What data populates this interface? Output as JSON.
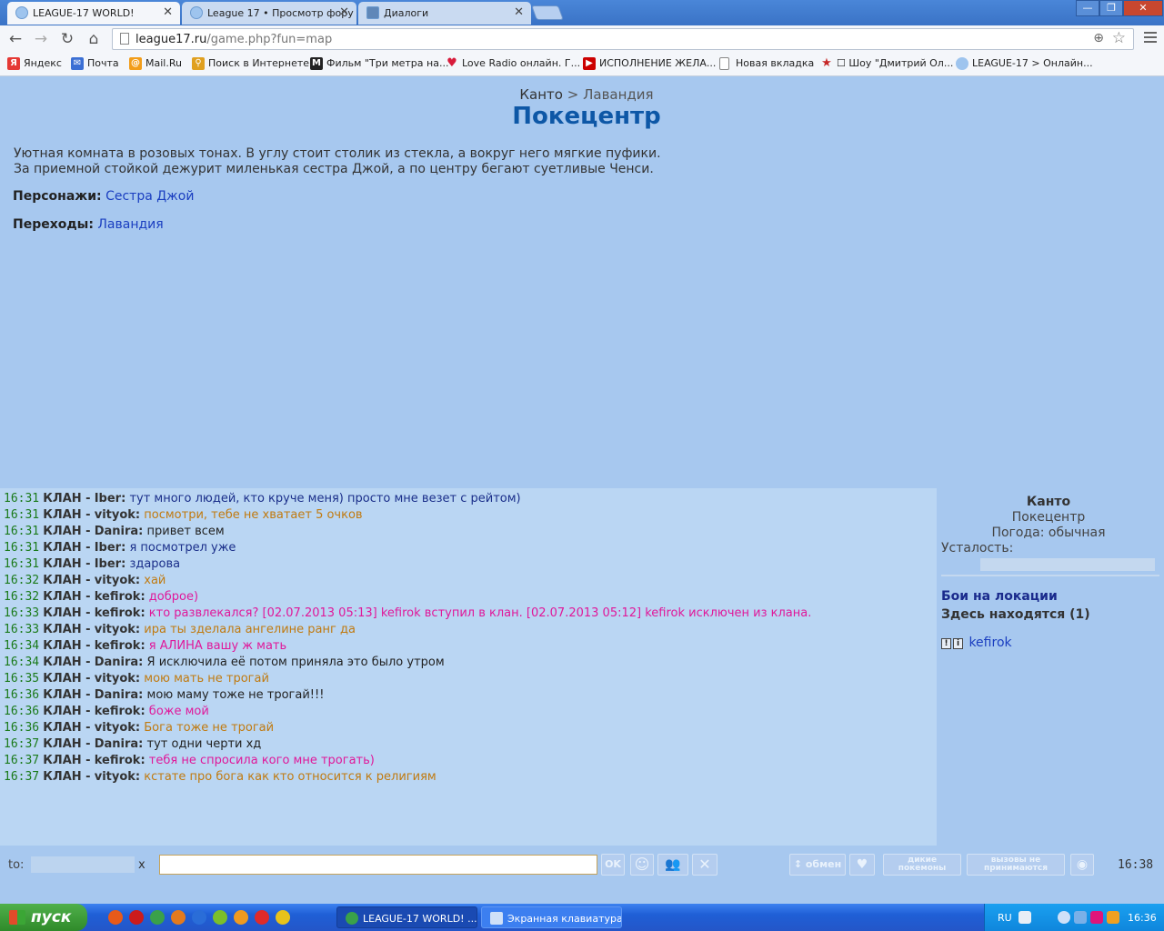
{
  "browser": {
    "tabs": [
      {
        "title": "LEAGUE-17 WORLD!",
        "active": true
      },
      {
        "title": "League 17 • Просмотр фору",
        "active": false
      },
      {
        "title": "Диалоги",
        "active": false
      }
    ],
    "url_host": "league17.ru",
    "url_path": "/game.php?fun=map",
    "bookmarks": [
      {
        "label": "Яндекс",
        "icon": "yandex-icon",
        "color": "#e53935"
      },
      {
        "label": "Почта",
        "icon": "mail-icon",
        "color": "#3b6fd4"
      },
      {
        "label": "Mail.Ru",
        "icon": "mailru-icon",
        "color": "#f29d1a"
      },
      {
        "label": "Поиск в Интернете",
        "icon": "search-icon",
        "color": "#e0a020"
      },
      {
        "label": "Фильм \"Три метра на...",
        "icon": "film-icon",
        "color": "#222222"
      },
      {
        "label": "Love Radio онлайн. Г...",
        "icon": "heart-icon",
        "color": "#d81b3b"
      },
      {
        "label": "ИСПОЛНЕНИЕ ЖЕЛА...",
        "icon": "youtube-icon",
        "color": "#cc0000"
      },
      {
        "label": "Новая вкладка",
        "icon": "page-icon",
        "color": "#ffffff"
      },
      {
        "label": "☐ Шоу \"Дмитрий Ол...",
        "icon": "star-icon",
        "color": "#c62828"
      },
      {
        "label": "LEAGUE-17 > Онлайн...",
        "icon": "league-icon",
        "color": "#9ec4ee"
      }
    ]
  },
  "location": {
    "region": "Канто",
    "separator": ">",
    "area": "Лавандия",
    "title": "Покецентр",
    "description_lines": [
      "Уютная комната в розовых тонах. В углу стоит столик из стекла, а вокруг него мягкие пуфики.",
      "За приемной стойкой дежурит миленькая сестра Джой, а по центру бегают суетливые Ченси."
    ],
    "characters_label": "Персонажи:",
    "characters_value": "Сестра Джой",
    "exits_label": "Переходы:",
    "exits_value": "Лавандия"
  },
  "chat": {
    "messages": [
      {
        "time": "16:31",
        "clan": "КЛАН -",
        "nick": "Iber:",
        "text": "тут много людей, кто круче меня) просто мне везет с рейтом)",
        "color": "#1b2f8a"
      },
      {
        "time": "16:31",
        "clan": "КЛАН -",
        "nick": "vityok:",
        "text": "посмотри, тебе не хватает 5 очков",
        "color": "#c07a10"
      },
      {
        "time": "16:31",
        "clan": "КЛАН -",
        "nick": "Danira:",
        "text": "привет всем",
        "color": "#222222"
      },
      {
        "time": "16:31",
        "clan": "КЛАН -",
        "nick": "Iber:",
        "text": "я посмотрел уже",
        "color": "#1b2f8a"
      },
      {
        "time": "16:31",
        "clan": "КЛАН -",
        "nick": "Iber:",
        "text": "здарова",
        "color": "#1b2f8a"
      },
      {
        "time": "16:32",
        "clan": "КЛАН -",
        "nick": "vityok:",
        "text": "хай",
        "color": "#c07a10"
      },
      {
        "time": "16:32",
        "clan": "КЛАН -",
        "nick": "kefirok:",
        "text": "доброе)",
        "color": "#e0189a"
      },
      {
        "time": "16:33",
        "clan": "КЛАН -",
        "nick": "kefirok:",
        "text": "кто развлекался? [02.07.2013 05:13] kefirok вступил в клан. [02.07.2013 05:12] kefirok исключен из клана.",
        "color": "#e0189a"
      },
      {
        "time": "16:33",
        "clan": "КЛАН -",
        "nick": "vityok:",
        "text": "ира ты зделала ангелине ранг да",
        "color": "#c07a10"
      },
      {
        "time": "16:34",
        "clan": "КЛАН -",
        "nick": "kefirok:",
        "text": "я АЛИНА вашу ж мать",
        "color": "#e0189a"
      },
      {
        "time": "16:34",
        "clan": "КЛАН -",
        "nick": "Danira:",
        "text": "Я исключила её потом приняла это было утром",
        "color": "#222222"
      },
      {
        "time": "16:35",
        "clan": "КЛАН -",
        "nick": "vityok:",
        "text": "мою мать не трогай",
        "color": "#c07a10"
      },
      {
        "time": "16:36",
        "clan": "КЛАН -",
        "nick": "Danira:",
        "text": "мою маму тоже не трогай!!!",
        "color": "#222222"
      },
      {
        "time": "16:36",
        "clan": "КЛАН -",
        "nick": "kefirok:",
        "text": "боже мой",
        "color": "#e0189a"
      },
      {
        "time": "16:36",
        "clan": "КЛАН -",
        "nick": "vityok:",
        "text": "Бога тоже не трогай",
        "color": "#c07a10"
      },
      {
        "time": "16:37",
        "clan": "КЛАН -",
        "nick": "Danira:",
        "text": "тут одни черти хд",
        "color": "#222222"
      },
      {
        "time": "16:37",
        "clan": "КЛАН -",
        "nick": "kefirok:",
        "text": "тебя не спросила кого мне трогать)",
        "color": "#e0189a"
      },
      {
        "time": "16:37",
        "clan": "КЛАН -",
        "nick": "vityok:",
        "text": "кстате про бога как кто относится к религиям",
        "color": "#c07a10"
      }
    ]
  },
  "side": {
    "region": "Канто",
    "location": "Покецентр",
    "weather": "Погода: обычная",
    "fatigue_label": "Усталость:",
    "battles_link": "Бои на локации",
    "here_label": "Здесь находятся (1)",
    "user_icon1": "!",
    "user_icon2": "i",
    "user_name": "kefirok"
  },
  "input": {
    "to_label": "to:",
    "clear": "x",
    "ok": "OK",
    "exchange": "обмен",
    "wild_line1": "дикие",
    "wild_line2": "покемоны",
    "calls_line1": "вызовы не",
    "calls_line2": "принимаются",
    "clock": "16:38"
  },
  "taskbar": {
    "start": "пуск",
    "tasks": [
      {
        "label": "LEAGUE-17 WORLD! ...",
        "active": true
      },
      {
        "label": "Экранная клавиатура",
        "active": false
      }
    ],
    "lang": "RU",
    "clock": "16:36"
  }
}
